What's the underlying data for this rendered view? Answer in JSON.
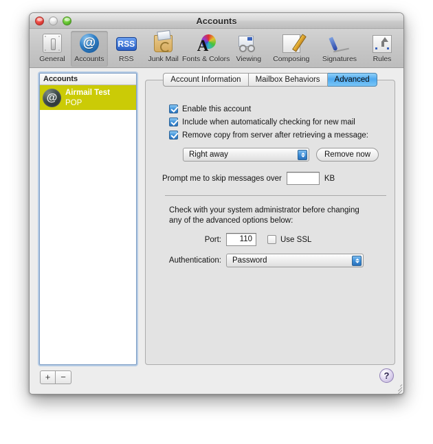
{
  "window": {
    "title": "Accounts",
    "controls": {
      "close": "close",
      "minimize": "minimize",
      "zoom": "zoom"
    }
  },
  "toolbar": {
    "items": [
      {
        "label": "General",
        "icon": "general-icon",
        "selected": false
      },
      {
        "label": "Accounts",
        "icon": "at-sign-icon",
        "selected": true
      },
      {
        "label": "RSS",
        "icon": "rss-icon",
        "selected": false
      },
      {
        "label": "Junk Mail",
        "icon": "junk-mail-icon",
        "selected": false
      },
      {
        "label": "Fonts & Colors",
        "icon": "fonts-colors-icon",
        "selected": false
      },
      {
        "label": "Viewing",
        "icon": "viewing-icon",
        "selected": false
      },
      {
        "label": "Composing",
        "icon": "composing-icon",
        "selected": false
      },
      {
        "label": "Signatures",
        "icon": "signatures-icon",
        "selected": false
      },
      {
        "label": "Rules",
        "icon": "rules-icon",
        "selected": false
      }
    ]
  },
  "sidebar": {
    "header": "Accounts",
    "accounts": [
      {
        "name": "Airmail Test",
        "type": "POP",
        "icon": "account-globe-icon",
        "selected": true
      }
    ],
    "add_button": "+",
    "remove_button": "−"
  },
  "tabs": [
    {
      "label": "Account Information",
      "active": false
    },
    {
      "label": "Mailbox Behaviors",
      "active": false
    },
    {
      "label": "Advanced",
      "active": true
    }
  ],
  "advanced": {
    "enable_account": {
      "label": "Enable this account",
      "checked": true
    },
    "include_check": {
      "label": "Include when automatically checking for new mail",
      "checked": true
    },
    "remove_copy": {
      "label": "Remove copy from server after retrieving a message:",
      "checked": true
    },
    "remove_schedule": {
      "value": "Right away"
    },
    "remove_now_button": "Remove now",
    "prompt_skip_label": "Prompt me to skip messages over",
    "prompt_skip_value": "",
    "prompt_skip_unit": "KB",
    "admin_note_line1": "Check with your system administrator before changing",
    "admin_note_line2": "any of the advanced options below:",
    "port_label": "Port:",
    "port_value": "110",
    "use_ssl": {
      "label": "Use SSL",
      "checked": false
    },
    "auth_label": "Authentication:",
    "auth_value": "Password"
  },
  "help_button": "?",
  "colors": {
    "selection": "#cbcb06",
    "active_tab": "#4ea9ef",
    "checkbox_on": "#3f92da",
    "focus_ring": "#7daadc"
  }
}
